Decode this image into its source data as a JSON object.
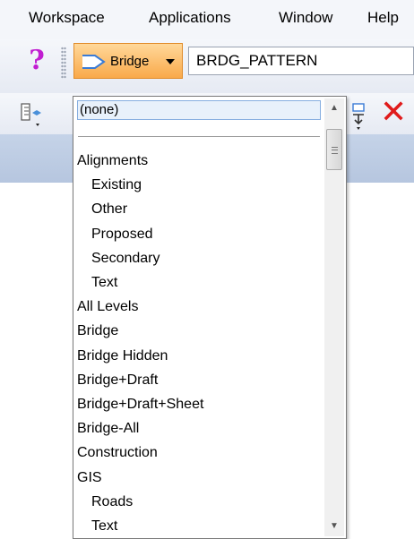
{
  "menubar": {
    "items": [
      "Workspace",
      "Applications",
      "Window",
      "Help"
    ]
  },
  "toolbar": {
    "help_icon": "?",
    "bridge_button": "Bridge",
    "level_value": "BRDG_PATTERN",
    "delete_icon": "✕"
  },
  "dropdown": {
    "selected": "(none)",
    "items": [
      {
        "label": "Alignments",
        "indent": 0
      },
      {
        "label": "Existing",
        "indent": 1
      },
      {
        "label": "Other",
        "indent": 1
      },
      {
        "label": "Proposed",
        "indent": 1
      },
      {
        "label": "Secondary",
        "indent": 1
      },
      {
        "label": "Text",
        "indent": 1
      },
      {
        "label": "All Levels",
        "indent": 0
      },
      {
        "label": "Bridge",
        "indent": 0
      },
      {
        "label": "Bridge Hidden",
        "indent": 0
      },
      {
        "label": "Bridge+Draft",
        "indent": 0
      },
      {
        "label": "Bridge+Draft+Sheet",
        "indent": 0
      },
      {
        "label": "Bridge-All",
        "indent": 0
      },
      {
        "label": "Construction",
        "indent": 0
      },
      {
        "label": "GIS",
        "indent": 0
      },
      {
        "label": "Roads",
        "indent": 1
      },
      {
        "label": "Text",
        "indent": 1
      }
    ]
  },
  "colors": {
    "accent_orange": "#f9a94a",
    "help_magenta": "#c11ed1",
    "delete_red": "#e01b1b",
    "selection_blue": "#86aee0"
  }
}
